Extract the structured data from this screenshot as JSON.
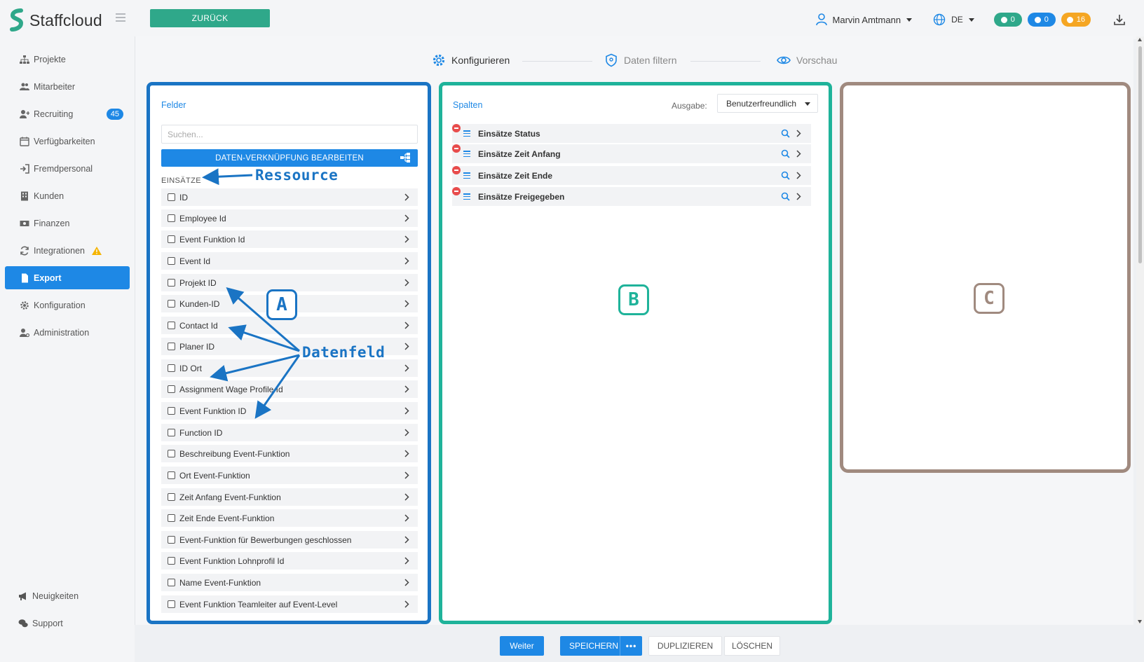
{
  "app": {
    "name": "Staffcloud",
    "back_label": "ZURÜCK",
    "user_name": "Marvin Amtmann",
    "language": "DE",
    "counters": {
      "messages": "0",
      "notifications": "0",
      "alerts": "16"
    },
    "colors": {
      "brand": "#2fa88a",
      "primary": "#1e88e5",
      "panel_a": "#1a74c4",
      "panel_b": "#1fb39a",
      "panel_c": "#a08a7f",
      "pill_green": "#2fa88a",
      "pill_blue": "#1e88e5",
      "pill_orange": "#f5a623",
      "remove": "#e84c4c"
    }
  },
  "sidebar": {
    "items": [
      {
        "label": "Projekte",
        "icon": "sitemap-icon"
      },
      {
        "label": "Mitarbeiter",
        "icon": "users-icon"
      },
      {
        "label": "Recruiting",
        "icon": "user-plus-icon",
        "badge": "45"
      },
      {
        "label": "Verfügbarkeiten",
        "icon": "calendar-icon"
      },
      {
        "label": "Fremdpersonal",
        "icon": "sign-in-icon"
      },
      {
        "label": "Kunden",
        "icon": "building-icon"
      },
      {
        "label": "Finanzen",
        "icon": "money-icon"
      },
      {
        "label": "Integrationen",
        "icon": "sync-icon",
        "warning": true
      },
      {
        "label": "Export",
        "icon": "file-icon",
        "active": true
      },
      {
        "label": "Konfiguration",
        "icon": "gear-icon"
      },
      {
        "label": "Administration",
        "icon": "user-cog-icon"
      }
    ],
    "bottom": [
      {
        "label": "Neuigkeiten",
        "icon": "megaphone-icon"
      },
      {
        "label": "Support",
        "icon": "comments-icon"
      }
    ]
  },
  "stepper": {
    "steps": [
      {
        "label": "Konfigurieren",
        "icon": "gear-icon",
        "active": true
      },
      {
        "label": "Daten filtern",
        "icon": "shield-icon"
      },
      {
        "label": "Vorschau",
        "icon": "eye-icon"
      }
    ]
  },
  "fields_panel": {
    "title": "Felder",
    "search_placeholder": "Suchen...",
    "link_button": "DATEN-VERKNÜPFUNG BEARBEITEN",
    "section": "EINSÄTZE",
    "items": [
      "ID",
      "Employee Id",
      "Event Funktion Id",
      "Event Id",
      "Projekt ID",
      "Kunden-ID",
      "Contact Id",
      "Planer ID",
      "ID Ort",
      "Assignment Wage Profile Id",
      "Event Funktion ID",
      "Function ID",
      "Beschreibung Event-Funktion",
      "Ort Event-Funktion",
      "Zeit Anfang Event-Funktion",
      "Zeit Ende Event-Funktion",
      "Event-Funktion für Bewerbungen geschlossen",
      "Event Funktion Lohnprofil Id",
      "Name Event-Funktion",
      "Event Funktion Teamleiter auf Event-Level"
    ]
  },
  "columns_panel": {
    "title": "Spalten",
    "output_label": "Ausgabe:",
    "output_value": "Benutzerfreundlich",
    "items": [
      "Einsätze Status",
      "Einsätze Zeit Anfang",
      "Einsätze Zeit Ende",
      "Einsätze Freigegeben"
    ]
  },
  "annotations": {
    "resource": "Ressource",
    "datafield": "Datenfeld",
    "letter_a": "A",
    "letter_b": "B",
    "letter_c": "C"
  },
  "actions": {
    "next": "Weiter",
    "save": "SPEICHERN",
    "more": "•••",
    "duplicate": "DUPLIZIEREN",
    "delete": "LÖSCHEN"
  }
}
